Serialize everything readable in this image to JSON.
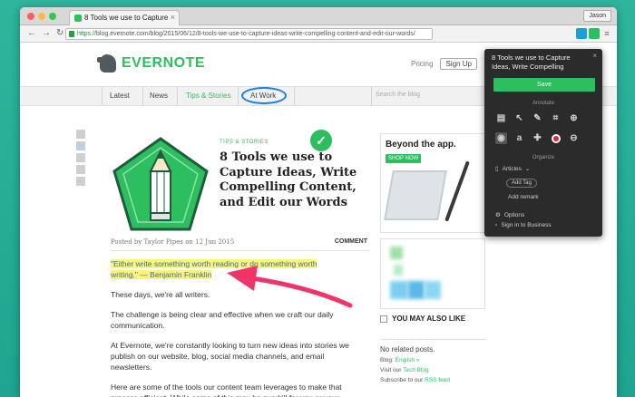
{
  "browser": {
    "tab_title": "8 Tools we use to Capture",
    "user_label": "Jason",
    "url_scheme": "https://",
    "url_host": "blog.evernote.com",
    "url_path": "/blog/2015/06/12/8-tools-we-use-to-capture-ideas-write-compelling-content-and-edit-our-words/"
  },
  "site": {
    "logo_text": "EVERNOTE",
    "pricing": "Pricing",
    "signup": "Sign Up",
    "nav": [
      "Latest",
      "News",
      "Tips & Stories",
      "At Work"
    ],
    "search_placeholder": "Search the blog",
    "brand_color": "#2dbe60"
  },
  "article": {
    "category": "TIPS & STORIES",
    "title": "8 Tools we use to Capture Ideas, Write Compelling Content, and Edit our Words",
    "byline": "Posted by Taylor Pipes on 12 Jun 2015",
    "comment_label": "COMMENT",
    "quote_line1": "\"Either write something worth reading or do something worth",
    "quote_line2": "writing.\" — Benjamin Franklin",
    "p1": "These days, we're all writers.",
    "p2": "The challenge is being clear and effective when we craft our daily communication.",
    "p3": "At Evernote, we're constantly looking to turn new ideas into stories we publish on our website, blog, social media channels, and email newsletters.",
    "p4": "Here are some of the tools our content team leverages to make that process efficient. While some of this may be overkill for you or your"
  },
  "sidebar": {
    "ad_title": "Beyond the app.",
    "ad_button": "SHOP NOW",
    "ymal": "YOU MAY ALSO LIKE",
    "no_related": "No related posts.",
    "blog_prefix": "Blog:",
    "blog_lang": "English »",
    "visit_prefix": "Visit our",
    "tech_blog": "Tech Blog",
    "subscribe_prefix": "Subscribe to our",
    "rss": "RSS feed"
  },
  "clipper": {
    "title": "8 Tools we use to Capture Ideas, Write Compelling",
    "save": "Save",
    "annotate": "Annotate",
    "organize": "Organize",
    "notebook": "Articles",
    "add_tag": "Add Tag",
    "add_remark": "Add remark",
    "options": "Options",
    "sign_in": "Sign in to Business"
  }
}
